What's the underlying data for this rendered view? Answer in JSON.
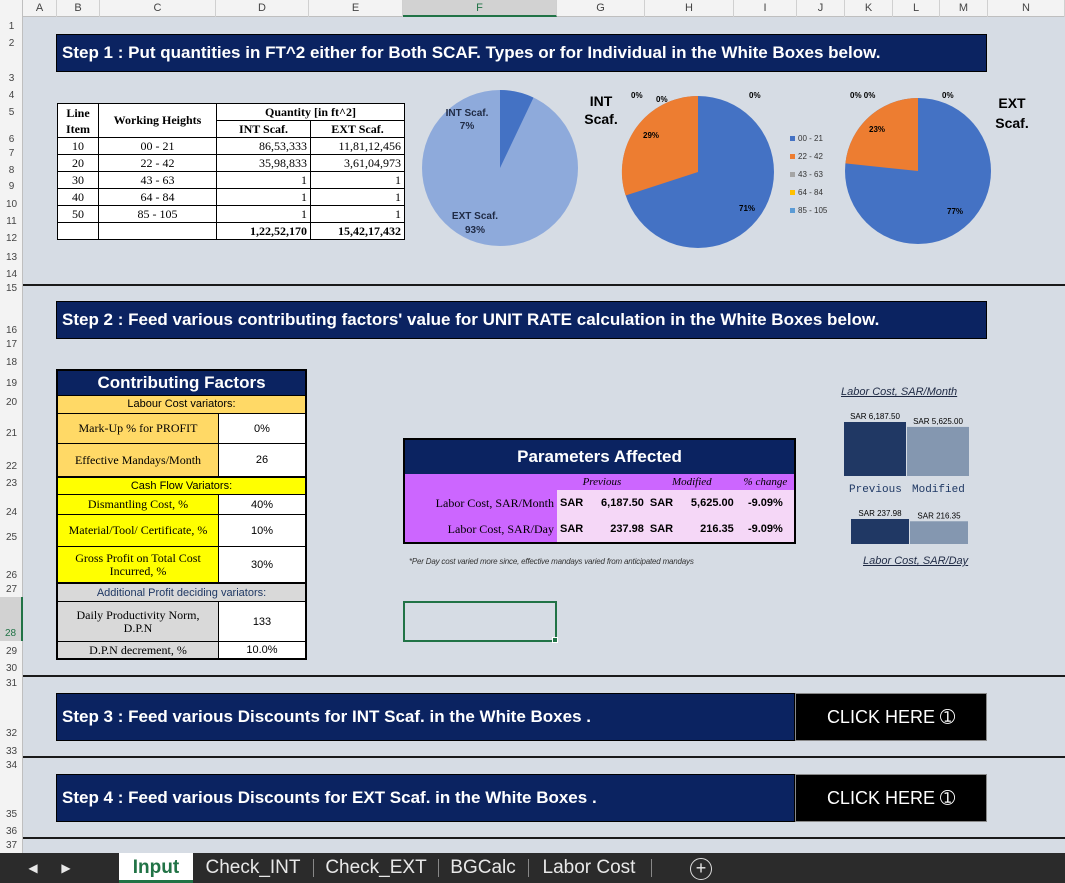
{
  "columns": [
    "A",
    "B",
    "C",
    "D",
    "E",
    "F",
    "G",
    "H",
    "I",
    "J",
    "K",
    "L",
    "M",
    "N"
  ],
  "rows": [
    "1",
    "2",
    "3",
    "4",
    "5",
    "6",
    "7",
    "8",
    "9",
    "10",
    "11",
    "12",
    "13",
    "14",
    "15",
    "16",
    "17",
    "18",
    "19",
    "20",
    "21",
    "22",
    "23",
    "24",
    "25",
    "26",
    "27",
    "28",
    "29",
    "30",
    "31",
    "32",
    "33",
    "34",
    "35",
    "36",
    "37"
  ],
  "selected": {
    "column": "F",
    "row": "28"
  },
  "step1": {
    "title": "Step 1 : Put quantities in FT^2 either for Both SCAF. Types or for Individual in the White Boxes below."
  },
  "step2": {
    "title": "Step 2 : Feed various contributing factors' value for UNIT RATE calculation in the White Boxes below."
  },
  "step3": {
    "title": "Step 3 : Feed various Discounts for INT Scaf. in the White Boxes .",
    "button": "CLICK HERE ➀"
  },
  "step4": {
    "title": "Step 4 : Feed various Discounts for EXT Scaf. in the White Boxes .",
    "button": "CLICK HERE ➀"
  },
  "qty_table": {
    "h_line": "Line Item",
    "h_heights": "Working Heights",
    "h_quantity": "Quantity [in ft^2]",
    "h_int": "INT Scaf.",
    "h_ext": "EXT Scaf.",
    "rows": [
      {
        "item": "10",
        "height": "00 - 21",
        "int": "86,53,333",
        "ext": "11,81,12,456"
      },
      {
        "item": "20",
        "height": "22 - 42",
        "int": "35,98,833",
        "ext": "3,61,04,973"
      },
      {
        "item": "30",
        "height": "43 - 63",
        "int": "1",
        "ext": "1"
      },
      {
        "item": "40",
        "height": "64 - 84",
        "int": "1",
        "ext": "1"
      },
      {
        "item": "50",
        "height": "85 - 105",
        "int": "1",
        "ext": "1"
      }
    ],
    "total_int": "1,22,52,170",
    "total_ext": "15,42,17,432"
  },
  "pie_charts": {
    "share": {
      "int_label": "INT Scaf.",
      "int_pct": "7%",
      "ext_label": "EXT Scaf.",
      "ext_pct": "93%"
    },
    "int": {
      "title_line1": "INT",
      "title_line2": "Scaf.",
      "labels": [
        "0%",
        "0%",
        "0%",
        "29%",
        "71%"
      ]
    },
    "ext": {
      "title_line1": "EXT",
      "title_line2": "Scaf.",
      "labels": [
        "0% 0%",
        "0%",
        "23%",
        "77%"
      ]
    },
    "legend": [
      "00 - 21",
      "22 - 42",
      "43 - 63",
      "64 - 84",
      "85 - 105"
    ],
    "legend_colors": [
      "#4472c4",
      "#ed7d31",
      "#a5a5a5",
      "#ffc000",
      "#5b9bd5"
    ]
  },
  "chart_data": [
    {
      "type": "pie",
      "categories": [
        "INT Scaf.",
        "EXT Scaf."
      ],
      "values": [
        7,
        93
      ]
    },
    {
      "type": "pie",
      "title": "INT Scaf.",
      "categories": [
        "00 - 21",
        "22 - 42",
        "43 - 63",
        "64 - 84",
        "85 - 105"
      ],
      "values": [
        71,
        29,
        0,
        0,
        0
      ]
    },
    {
      "type": "pie",
      "title": "EXT Scaf.",
      "categories": [
        "00 - 21",
        "22 - 42",
        "43 - 63",
        "64 - 84",
        "85 - 105"
      ],
      "values": [
        77,
        23,
        0,
        0,
        0
      ]
    },
    {
      "type": "bar",
      "title": "Labor Cost, SAR/Month",
      "categories": [
        "Previous",
        "Modified"
      ],
      "values": [
        6187.5,
        5625.0
      ]
    },
    {
      "type": "bar",
      "title": "Labor Cost, SAR/Day",
      "categories": [
        "Previous",
        "Modified"
      ],
      "values": [
        237.98,
        216.35
      ]
    }
  ],
  "contributing": {
    "title": "Contributing Factors",
    "sec_labour": "Labour Cost variators:",
    "markup_label": "Mark-Up % for PROFIT",
    "markup_value": "0%",
    "mandays_label": "Effective Mandays/Month",
    "mandays_value": "26",
    "sec_cash": "Cash Flow Variators:",
    "dismantling_label": "Dismantling Cost, %",
    "dismantling_value": "40%",
    "material_label": "Material/Tool/ Certificate, %",
    "material_value": "10%",
    "gross_label": "Gross Profit on Total Cost Incurred, %",
    "gross_value": "30%",
    "sec_additional": "Additional Profit deciding variators:",
    "dpn_label": "Daily Productivity Norm, D.P.N",
    "dpn_value": "133",
    "dpn_dec_label": "D.P.N decrement, %",
    "dpn_dec_value": "10.0%"
  },
  "params": {
    "title": "Parameters Affected",
    "h_previous": "Previous",
    "h_modified": "Modified",
    "h_change": "% change",
    "rows": [
      {
        "label": "Labor Cost, SAR/Month",
        "prev_cur": "SAR",
        "prev": "6,187.50",
        "mod_cur": "SAR",
        "mod": "5,625.00",
        "change": "-9.09%"
      },
      {
        "label": "Labor Cost, SAR/Day",
        "prev_cur": "SAR",
        "prev": "237.98",
        "mod_cur": "SAR",
        "mod": "216.35",
        "change": "-9.09%"
      }
    ],
    "note": "*Per Day cost varied more since, effective mandays varied from anticipated mandays"
  },
  "mini_month": {
    "title": "Labor Cost, SAR/Month",
    "prev_label": "SAR 6,187.50",
    "mod_label": "SAR 5,625.00",
    "legend_prev": "Previous",
    "legend_mod": "Modified"
  },
  "mini_day": {
    "title": "Labor Cost, SAR/Day",
    "prev_label": "SAR 237.98",
    "mod_label": "SAR 216.35"
  },
  "tabs": [
    "Input",
    "Check_INT",
    "Check_EXT",
    "BGCalc",
    "Labor Cost"
  ],
  "active_tab": "Input",
  "add_sheet": "+"
}
